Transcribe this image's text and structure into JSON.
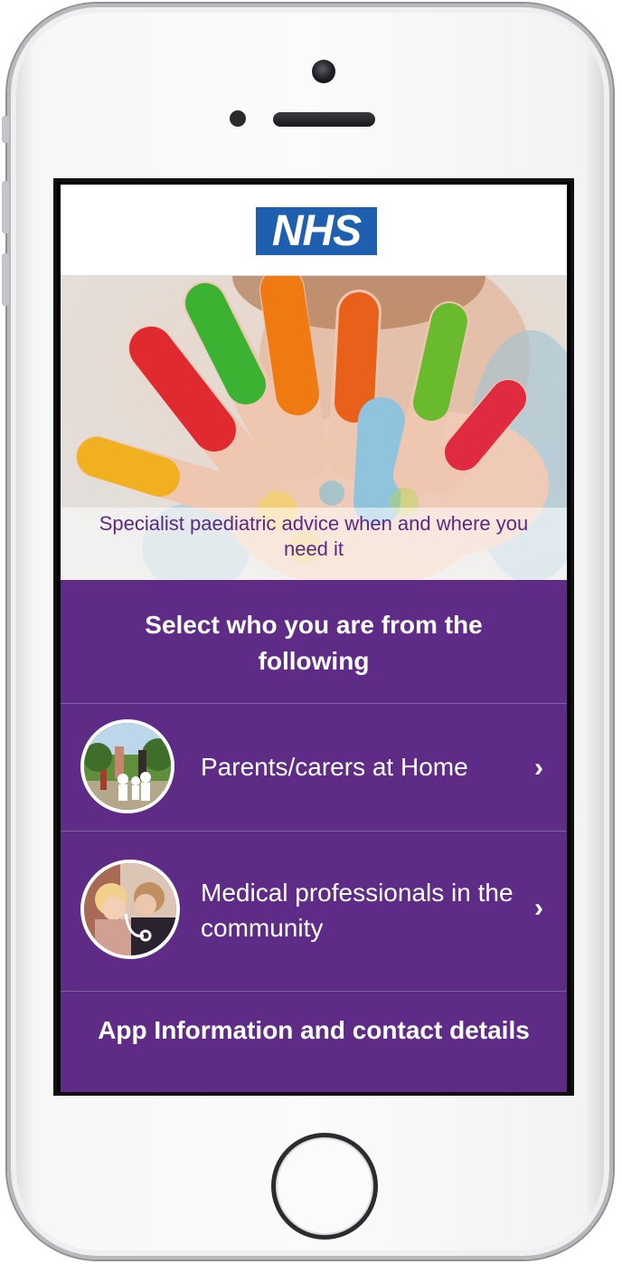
{
  "header": {
    "logo_text": "NHS",
    "brand_color": "#1f5fb0"
  },
  "hero": {
    "caption": "Specialist paediatric advice when and where you need it"
  },
  "main": {
    "title": "Select who you are from the following",
    "options": [
      {
        "label": "Parents/carers at Home",
        "icon": "family-photo"
      },
      {
        "label": "Medical professionals in the community",
        "icon": "doctor-child-photo"
      }
    ],
    "info_title": "App Information and contact details"
  },
  "theme": {
    "accent": "#5e2b86",
    "text_accent": "#5b2a80"
  }
}
